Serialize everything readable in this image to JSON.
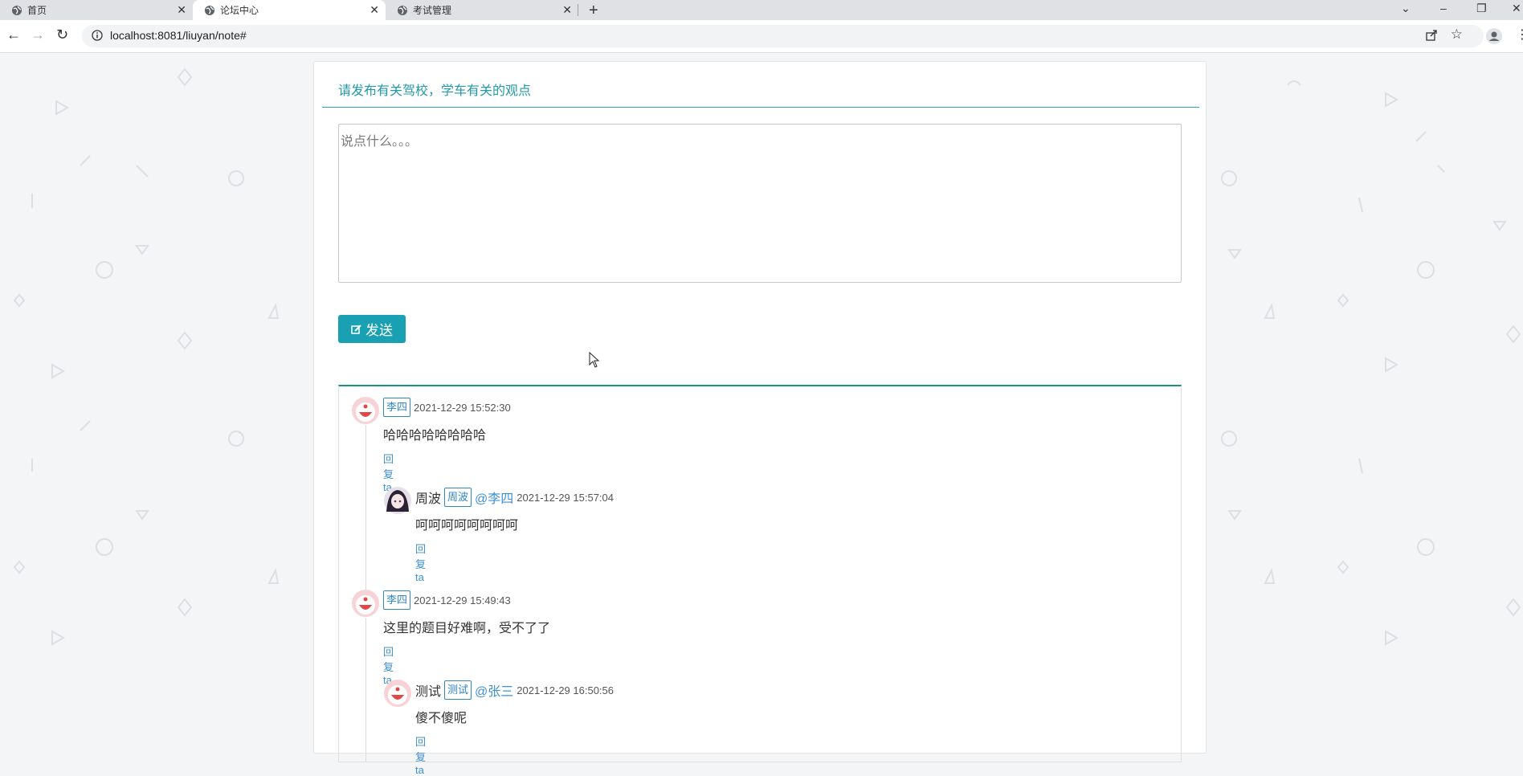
{
  "browser": {
    "tabs": [
      {
        "label": "首页",
        "active": false
      },
      {
        "label": "论坛中心",
        "active": true
      },
      {
        "label": "考试管理",
        "active": false
      }
    ],
    "url": "localhost:8081/liuyan/note#"
  },
  "forum": {
    "heading": "请发布有关驾校，学车有关的观点",
    "input_placeholder": "说点什么。。。",
    "send_label": "发送"
  },
  "comments": [
    {
      "role_tag": "李四",
      "time": "2021-12-29 15:52:30",
      "text": "哈哈哈哈哈哈哈哈",
      "reply_label": "回复ta",
      "replies": [
        {
          "name": "周波",
          "role_tag": "周波",
          "mention": "@李四",
          "time": "2021-12-29 15:57:04",
          "text": "呵呵呵呵呵呵呵呵",
          "reply_label": "回复ta",
          "avatar": "anime-girl"
        }
      ]
    },
    {
      "role_tag": "李四",
      "time": "2021-12-29 15:49:43",
      "text": "这里的题目好难啊，受不了了",
      "reply_label": "回复ta",
      "replies": [
        {
          "name": "测试",
          "role_tag": "测试",
          "mention": "@张三",
          "time": "2021-12-29 16:50:56",
          "text": "傻不傻呢",
          "reply_label": "回复ta",
          "avatar": "doraemon"
        }
      ]
    }
  ],
  "colors": {
    "accent": "#1aa0b3",
    "link": "#3f8fd1",
    "panel_top_border": "#1c8f83"
  }
}
